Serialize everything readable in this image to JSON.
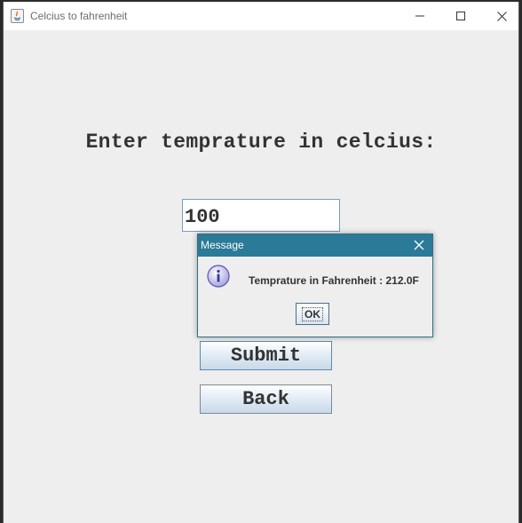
{
  "window": {
    "title": "Celcius to fahrenheit",
    "icon": "java-icon"
  },
  "main": {
    "prompt": "Enter temprature in celcius:",
    "celsius_value": "100",
    "submit_label": "Submit",
    "back_label": "Back"
  },
  "dialog": {
    "title": "Message",
    "icon": "info-icon",
    "message": "Temprature in Fahrenheit : 212.0F",
    "ok_label": "OK"
  },
  "colors": {
    "dialog_title_bg": "#2a7a98",
    "background": "#eeeeee",
    "text": "#333333"
  }
}
